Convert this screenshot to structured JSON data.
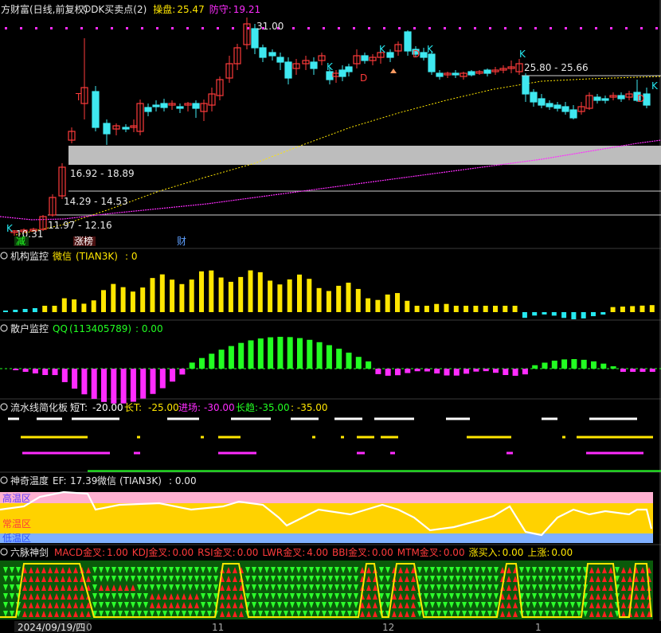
{
  "colors": {
    "up": "#ff3b3b",
    "down": "#3fe8f0",
    "yellow": "#ffe600",
    "magenta": "#ff2cff",
    "green": "#22ff22",
    "cyan": "#24e8f0",
    "white": "#ffffff",
    "grey_band": "#bdbdbd",
    "pink": "#ffb0d0",
    "orange_zone": "#ffd200",
    "blue_zone": "#7fb0ff"
  },
  "main_panel": {
    "title": "方财富(日线,前复权)",
    "dk_label": "DK买卖点(2)",
    "caopan_label": "操盘:",
    "caopan_value": "25.47",
    "fangshou_label": "防守:",
    "fangshou_value": "19.21",
    "price_high_label": "31.00",
    "price_low_label": "10.31",
    "resistance_label": "25.80 - 25.66",
    "band_labels": [
      "16.92 - 18.89",
      "14.29 - 14.53",
      "11.97 - 12.16"
    ],
    "tags": [
      "减",
      "涨榜",
      "财"
    ]
  },
  "panel_jigou": {
    "title": "机构监控",
    "weixin_label": "微信",
    "weixin_value": "(TIAN3K)",
    "value": ": 0"
  },
  "panel_sanhu": {
    "title": "散户监控",
    "qq_label": "QQ",
    "qq_value": "(113405789)",
    "value": ": 0.00"
  },
  "panel_liushui": {
    "title": "流水线简化板",
    "duan_label": "短T:",
    "duan_value": "-20.00",
    "chang_label": "长T:",
    "chang_value": "-25.00",
    "jinchang_label": "进场:",
    "jinchang_value": "-30.00",
    "changqu_label": "长趋:",
    "changqu_value": "-35.00",
    "extra_value": ": -35.00"
  },
  "panel_wendu": {
    "title": "神奇温度",
    "ef_label": "EF:",
    "ef_value": "17.39",
    "weixin_label": "微信",
    "weixin_value": "(TIAN3K)",
    "value": ": 0.00",
    "zones": [
      "高温区",
      "常温区",
      "低温区"
    ]
  },
  "panel_liumai": {
    "title": "六脉神剑",
    "items": [
      {
        "label": "MACD金叉:",
        "value": "1.00"
      },
      {
        "label": "KDJ金叉:",
        "value": "0.00"
      },
      {
        "label": "RSI金叉:",
        "value": "0.00"
      },
      {
        "label": "LWR金叉:",
        "value": "4.00"
      },
      {
        "label": "BBI金叉:",
        "value": "0.00"
      },
      {
        "label": "MTM金叉:",
        "value": "0.00"
      },
      {
        "label": "涨买入:",
        "value": "0.00"
      },
      {
        "label": "上涨:",
        "value": "0.00"
      }
    ]
  },
  "axis": {
    "date_label": "2024/09/19/四",
    "month_labels": [
      "0",
      "11",
      "12",
      "1"
    ]
  }
}
